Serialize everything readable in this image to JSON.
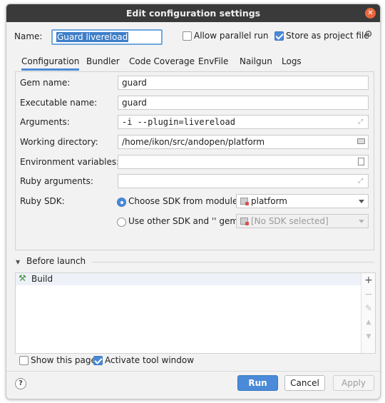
{
  "window": {
    "title": "Edit configuration settings"
  },
  "header": {
    "name_label": "Name:",
    "name_value": "Guard livereload",
    "allow_parallel_label": "Allow parallel run",
    "allow_parallel_checked": false,
    "store_project_label": "Store as project file",
    "store_project_checked": true,
    "settings_icon": "gear-icon"
  },
  "tabs": [
    {
      "label": "Configuration",
      "active": true
    },
    {
      "label": "Bundler"
    },
    {
      "label": "Code Coverage"
    },
    {
      "label": "EnvFile"
    },
    {
      "label": "Nailgun"
    },
    {
      "label": "Logs"
    }
  ],
  "form": {
    "gem_name": {
      "label": "Gem name:",
      "value": "guard"
    },
    "executable_name": {
      "label": "Executable name:",
      "value": "guard"
    },
    "arguments": {
      "label": "Arguments:",
      "value": "-i --plugin=livereload"
    },
    "working_directory": {
      "label": "Working directory:",
      "value": "/home/ikon/src/andopen/platform"
    },
    "environment_variables": {
      "label": "Environment variables:",
      "value": ""
    },
    "ruby_arguments": {
      "label": "Ruby arguments:",
      "value": ""
    },
    "ruby_sdk": {
      "label": "Ruby SDK:",
      "choose_module_label": "Choose SDK from module:",
      "module_value": "platform",
      "use_other_label": "Use other SDK and '' gem:",
      "other_value": "[No SDK selected]"
    }
  },
  "before_launch": {
    "title": "Before launch",
    "items": [
      {
        "label": "Build",
        "icon": "hammer-icon"
      }
    ],
    "toolbar": {
      "add": "+",
      "remove": "−"
    }
  },
  "footer": {
    "show_page_label": "Show this page",
    "show_page_checked": false,
    "activate_tool_label": "Activate tool window",
    "activate_tool_checked": true,
    "help": "?",
    "run_label": "Run",
    "cancel_label": "Cancel",
    "apply_label": "Apply"
  },
  "colors": {
    "accent": "#4a8ad8",
    "titlebar": "#3a3a3a",
    "close": "#e9663d"
  }
}
